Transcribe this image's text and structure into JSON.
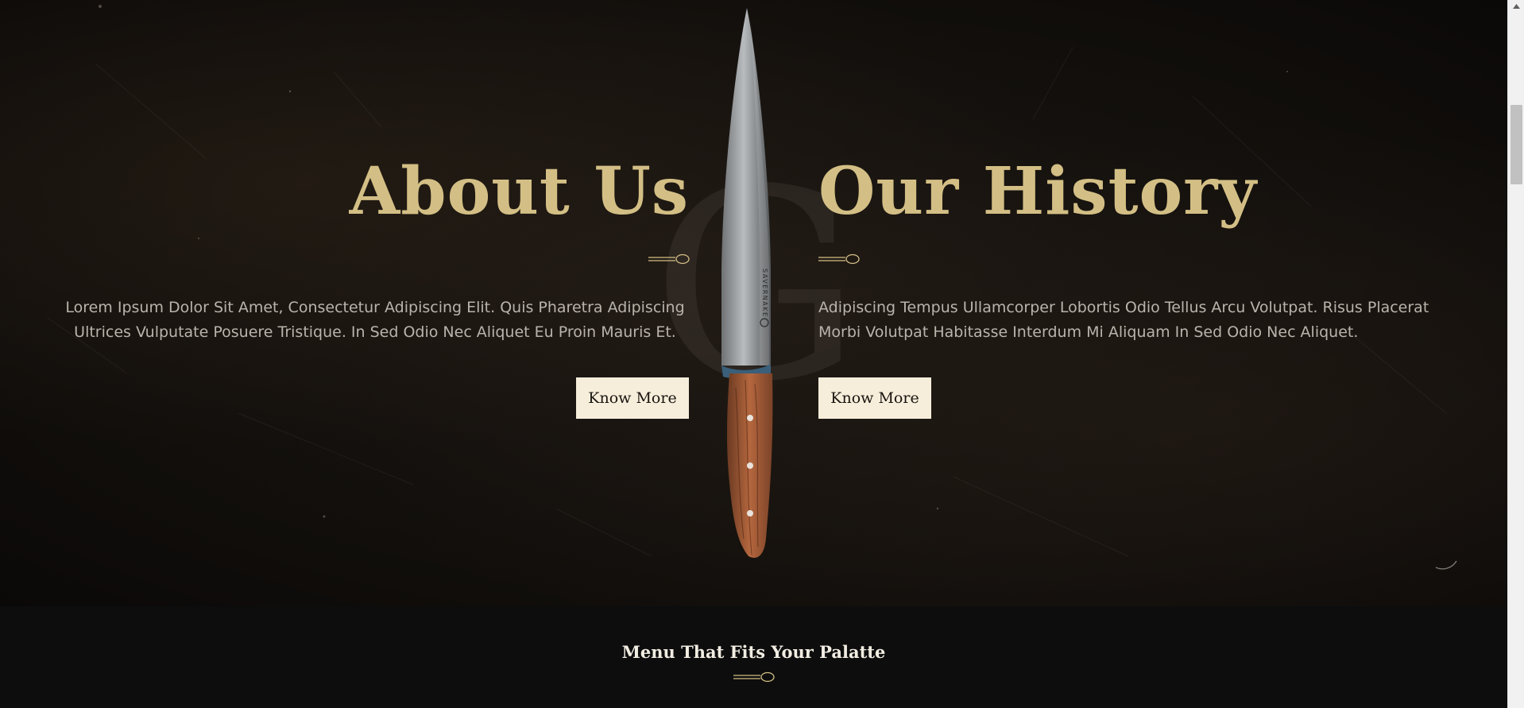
{
  "about": {
    "heading": "About Us",
    "text": "Lorem Ipsum Dolor Sit Amet, Consectetur Adipiscing Elit. Quis Pharetra Adipiscing Ultrices Vulputate Posuere Tristique. In Sed Odio Nec Aliquet Eu Proin Mauris Et.",
    "button_label": "Know More"
  },
  "history": {
    "heading": "Our History",
    "text": "Adipiscing Tempus Ullamcorper Lobortis Odio Tellus Arcu Volutpat. Risus Placerat Morbi Volutpat Habitasse Interdum Mi Aliquam In Sed Odio Nec Aliquet.",
    "button_label": "Know More"
  },
  "ghost_letter": "G",
  "knife": {
    "blade_brand": "SAVERNAKE"
  },
  "menu": {
    "title": "Menu That Fits Your Palatte"
  },
  "colors": {
    "accent_gold": "#d3bf85",
    "button_bg": "#f6eedb",
    "body_text": "#b9b4ab",
    "dark_bg": "#0d0d0d"
  },
  "icons": [
    "spoon-divider-icon",
    "knife-image",
    "scroll-up-arrow-icon"
  ]
}
